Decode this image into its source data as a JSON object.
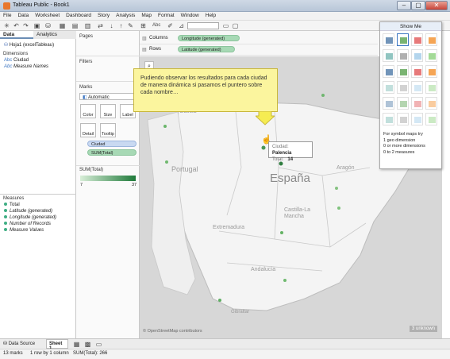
{
  "window": {
    "title": "Tableau Public - Book1",
    "min": "–",
    "max": "▢",
    "close": "✕"
  },
  "menu": [
    "File",
    "Data",
    "Worksheet",
    "Dashboard",
    "Story",
    "Analysis",
    "Map",
    "Format",
    "Window",
    "Help"
  ],
  "data_pane": {
    "tabs": [
      "Data",
      "Analytics"
    ],
    "source": "Hoja1 (excelTableau)",
    "dimensions_header": "Dimensions",
    "dimensions": [
      "Ciudad",
      "Measure Names"
    ],
    "measures_header": "Measures",
    "measures": [
      "Total",
      "Latitude (generated)",
      "Longitude (generated)",
      "Number of Records",
      "Measure Values"
    ]
  },
  "shelves": {
    "pages": "Pages",
    "filters": "Filters",
    "marks": "Marks",
    "mark_type": "Automatic",
    "buttons": [
      "Color",
      "Size",
      "Label",
      "Detail",
      "Tooltip"
    ],
    "mark_pills": [
      "Ciudad",
      "SUM(Total)"
    ],
    "legend_title": "SUM(Total)",
    "legend_min": "7",
    "legend_max": "37"
  },
  "view": {
    "columns_label": "Columns",
    "columns_pill": "Longitude (generated)",
    "rows_label": "Rows",
    "rows_pill": "Latitude (generated)"
  },
  "callout": "Pudiendo observar los resultados para cada ciudad de manera dinámica si pasamos el puntero sobre cada nombre…",
  "tooltip": {
    "k1": "Ciudad:",
    "v1": "Palencia",
    "k2": "Total:",
    "v2": "14"
  },
  "map_labels": {
    "galicia": "Galicia",
    "portugal": "Portugal",
    "espana": "España",
    "aragon": "Aragón",
    "castilla": "Castilla-La Mancha",
    "extremadura": "Extremadura",
    "andalucia": "Andalucía",
    "gibraltar": "Gibraltar",
    "osm": "© OpenStreetMap contributors",
    "unknown": "3 unknown"
  },
  "show_me": {
    "title": "Show Me",
    "hint_title": "For symbol maps try",
    "hint1": "1 geo dimension",
    "hint2": "0 or more dimensions",
    "hint3": "0 to 2 measures"
  },
  "bottom": {
    "datasource": "Data Source",
    "sheet": "Sheet 1"
  },
  "status": {
    "marks": "13 marks",
    "rows": "1 row by 1 column",
    "sum": "SUM(Total): 266"
  },
  "colors": {
    "accent": "#3fae84",
    "callout": "#fbf59e",
    "map_bg": "#d7d7d7"
  }
}
